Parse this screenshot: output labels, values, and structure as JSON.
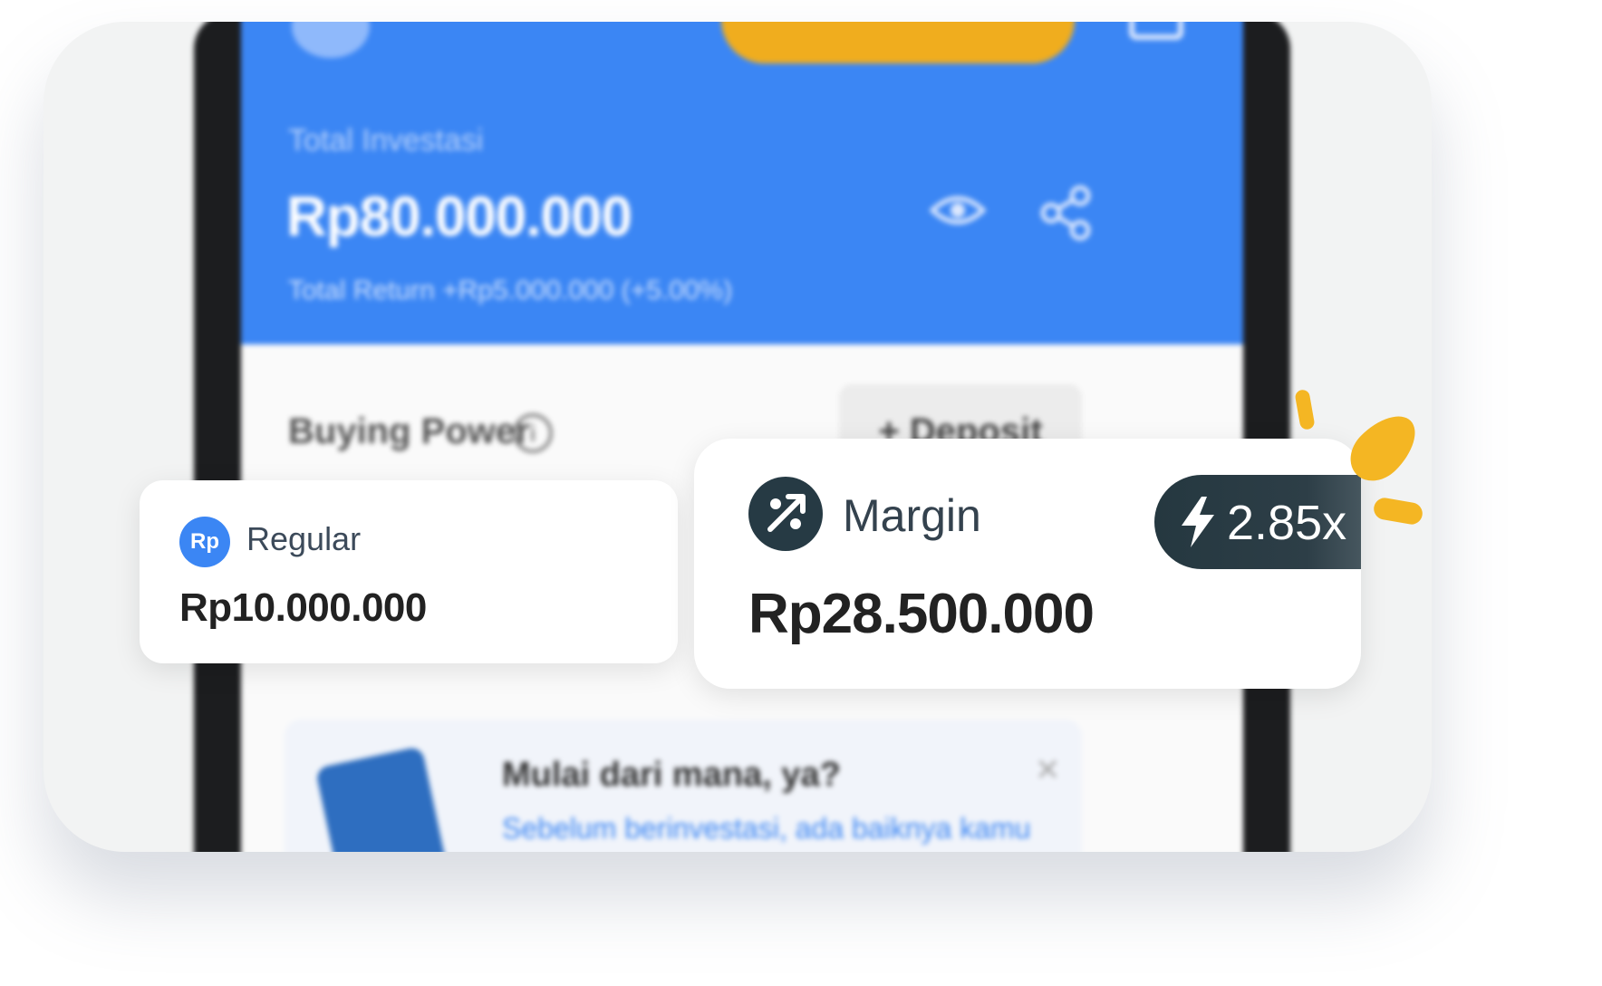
{
  "phone": {
    "total_investasi_label": "Total Investasi",
    "total_investasi_value": "Rp80.000.000",
    "total_return": "Total Return +Rp5.000.000 (+5.00%)",
    "buying_power_label": "Buying Power",
    "deposit_label": "+  Deposit",
    "banner_title": "Mulai dari mana, ya?",
    "banner_subtitle": "Sebelum berinvestasi, ada baiknya kamu"
  },
  "regular": {
    "badge": "Rp",
    "label": "Regular",
    "value": "Rp10.000.000"
  },
  "margin": {
    "label": "Margin",
    "value": "Rp28.500.000",
    "leverage": "2.85x"
  },
  "colors": {
    "primary_blue": "#3b86f4",
    "accent_yellow": "#f4b623",
    "dark_badge": "#263a44"
  },
  "icons": [
    "eye-icon",
    "share-icon",
    "info-icon",
    "percent-trend-icon",
    "lightning-icon",
    "close-icon"
  ]
}
